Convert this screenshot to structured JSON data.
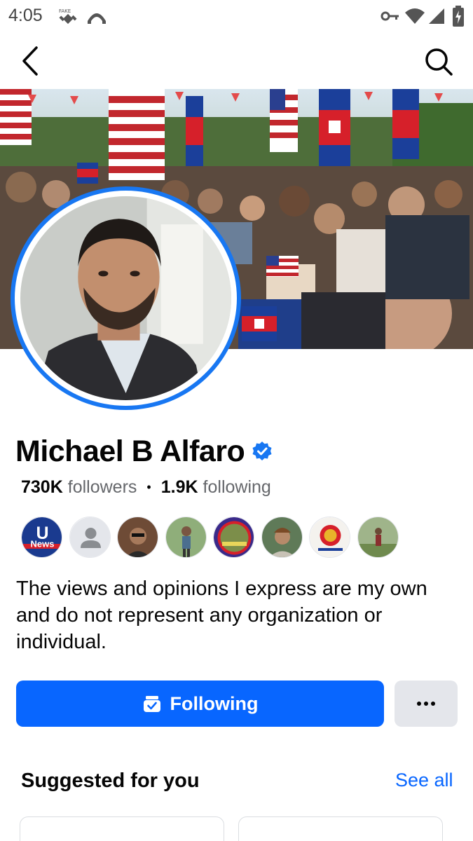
{
  "status_bar": {
    "time": "4:05",
    "icons": [
      "satellite-icon",
      "signal-arc-icon",
      "vpn-key-icon",
      "wifi-icon",
      "cell-signal-icon",
      "battery-icon"
    ]
  },
  "nav": {
    "back_icon": "chevron-left-icon",
    "search_icon": "search-icon"
  },
  "profile": {
    "name": "Michael B Alfaro",
    "verified_icon": "verified-badge-icon",
    "followers_count": "730K",
    "followers_label": "followers",
    "separator": "•",
    "following_count": "1.9K",
    "following_label": "following",
    "bio": "The views and opinions I express are my own and do not represent any organization or individual."
  },
  "mutual_friends": [
    {
      "kind": "logo",
      "text": "U",
      "subtext": "News"
    },
    {
      "kind": "default-avatar"
    },
    {
      "kind": "photo"
    },
    {
      "kind": "photo"
    },
    {
      "kind": "photo"
    },
    {
      "kind": "photo"
    },
    {
      "kind": "emblem"
    },
    {
      "kind": "photo"
    }
  ],
  "actions": {
    "following_label": "Following",
    "following_icon": "following-check-icon",
    "more_icon": "more-dots-icon"
  },
  "suggested": {
    "title": "Suggested for you",
    "see_all": "See all"
  },
  "colors": {
    "accent": "#0866ff",
    "verified": "#1877f2",
    "secondary_text": "#65676b",
    "button_gray": "#e4e6eb"
  }
}
